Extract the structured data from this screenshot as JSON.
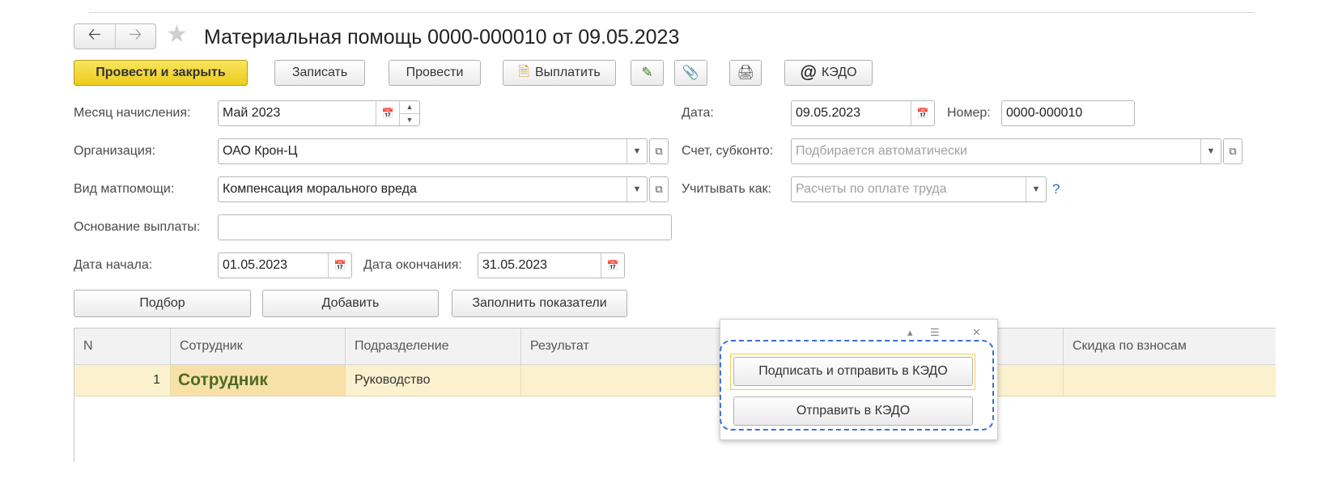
{
  "header": {
    "back_icon": "arrow-left-icon",
    "forward_icon": "arrow-right-icon",
    "favorite_icon": "star-icon",
    "title": "Материальная помощь 0000-000010 от 09.05.2023"
  },
  "toolbar": {
    "post_close": "Провести и закрыть",
    "save": "Записать",
    "post": "Провести",
    "pay": "Выплатить",
    "kedo": "КЭДО"
  },
  "form": {
    "month_label": "Месяц начисления:",
    "month_value": "Май 2023",
    "date_label": "Дата:",
    "date_value": "09.05.2023",
    "number_label": "Номер:",
    "number_value": "0000-000010",
    "org_label": "Организация:",
    "org_value": "ОАО Крон-Ц",
    "account_label": "Счет, субконто:",
    "account_placeholder": "Подбирается автоматически",
    "aid_type_label": "Вид матпомощи:",
    "aid_type_value": "Компенсация морального вреда",
    "consider_label": "Учитывать как:",
    "consider_placeholder": "Расчеты по оплате труда",
    "help": "?",
    "reason_label": "Основание выплаты:",
    "reason_value": "",
    "start_label": "Дата начала:",
    "start_value": "01.05.2023",
    "end_label": "Дата окончания:",
    "end_value": "31.05.2023"
  },
  "table_toolbar": {
    "pick": "Подбор",
    "add": "Добавить",
    "fill": "Заполнить показатели"
  },
  "table": {
    "columns": [
      "N",
      "Сотрудник",
      "Подразделение",
      "Результат",
      "Скидка по взносам"
    ],
    "rows": [
      {
        "n": "1",
        "employee": "Сотрудник",
        "department": "Руководство",
        "result": "",
        "discount": ""
      }
    ]
  },
  "popup": {
    "sign_send": "Подписать и отправить в КЭДО",
    "send": "Отправить в КЭДО"
  },
  "colors": {
    "primary_button": "#f1d535",
    "selected_row": "#fbf1cf",
    "dashed_outline": "#3a6fd8"
  }
}
